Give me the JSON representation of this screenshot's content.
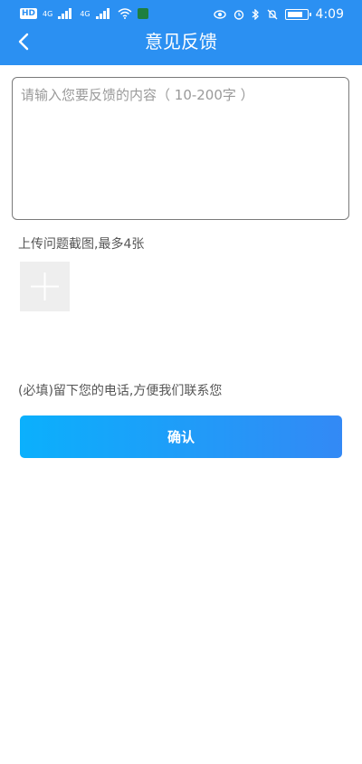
{
  "status_bar": {
    "hd_badge": "HD",
    "time": "4:09",
    "signal_label_1": "4G",
    "signal_label_2": "4G"
  },
  "header": {
    "title": "意见反馈"
  },
  "form": {
    "feedback_placeholder": "请输入您要反馈的内容（ 10-200字 ）",
    "upload_label": "上传问题截图,最多4张",
    "phone_label": "(必填)留下您的电话,方便我们联系您",
    "confirm_label": "确认"
  },
  "colors": {
    "header_bg": "#2b90f2",
    "button_gradient_start": "#0bb0fc",
    "button_gradient_end": "#3389f5"
  }
}
